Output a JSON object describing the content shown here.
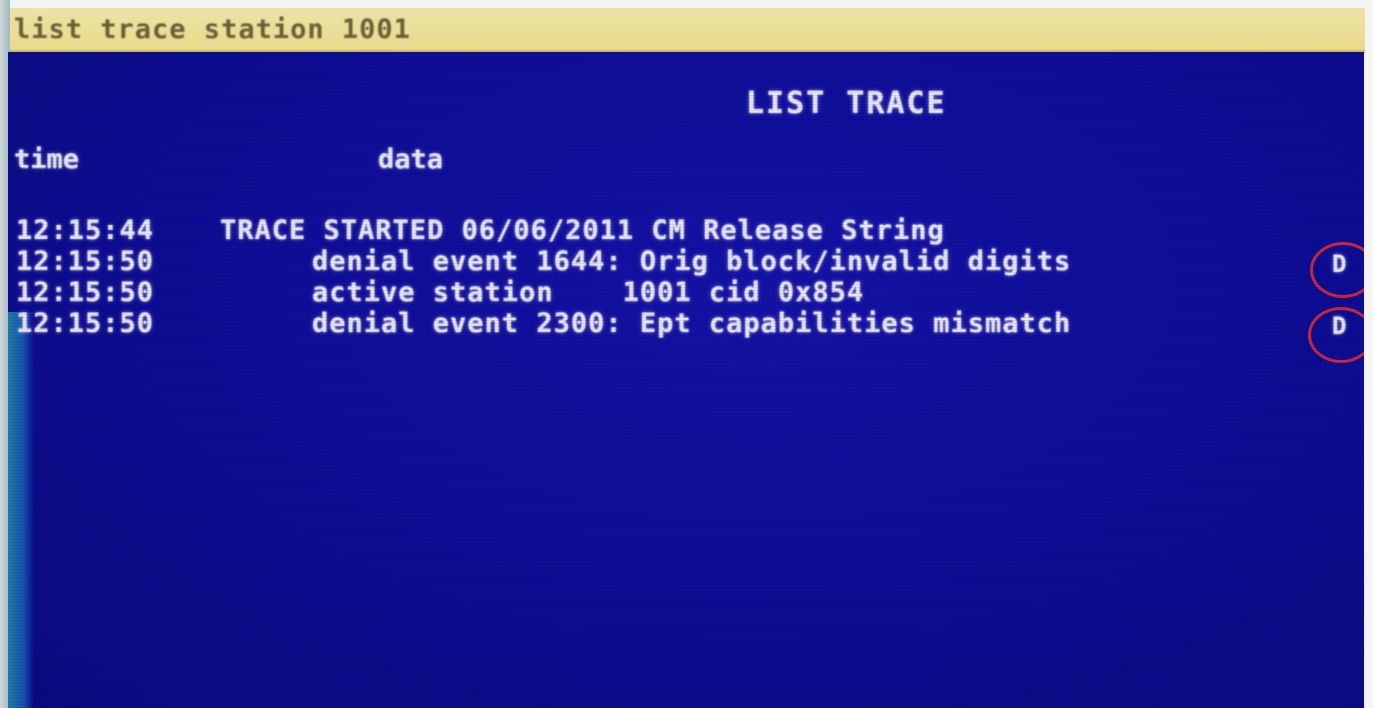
{
  "command": {
    "text": "list trace station 1001"
  },
  "screen": {
    "title": "LIST TRACE",
    "columns": {
      "time": "time",
      "data": "data"
    },
    "rows": [
      {
        "time": "12:15:44",
        "data": "TRACE STARTED 06/06/2011 CM Release String"
      },
      {
        "time": "12:15:50",
        "data": "denial event 1644: Orig block/invalid digits",
        "trail": "D"
      },
      {
        "time": "12:15:50",
        "data": "active station    1001 cid 0x854"
      },
      {
        "time": "12:15:50",
        "data": "denial event 2300: Ept capabilities mismatch",
        "trail": "D"
      }
    ]
  },
  "colors": {
    "screen_bg": "#0d0d94",
    "command_bar_bg": "#e8d98a",
    "text": "#e8e6f2",
    "highlight_marker": "#c8283a"
  }
}
